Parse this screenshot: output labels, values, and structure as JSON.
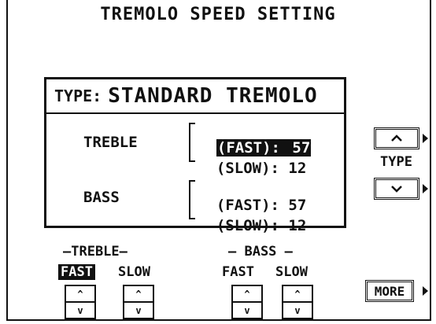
{
  "header": {
    "title": "TREMOLO SPEED SETTING"
  },
  "panel": {
    "type_prefix": "TYPE:",
    "type_name": "STANDARD TREMOLO",
    "treble": {
      "label": "TREBLE",
      "fast": {
        "label": "(FAST):",
        "value": "57"
      },
      "slow": {
        "label": "(SLOW):",
        "value": "12"
      }
    },
    "bass": {
      "label": "BASS",
      "fast": {
        "label": "(FAST):",
        "value": "57"
      },
      "slow": {
        "label": "(SLOW):",
        "value": "12"
      }
    }
  },
  "type_selector": {
    "label": "TYPE",
    "up_icon": "chevron-up",
    "down_icon": "chevron-down"
  },
  "controls": {
    "treble": {
      "group_label": "—TREBLE—",
      "fast_label": "FAST",
      "slow_label": "SLOW"
    },
    "bass": {
      "group_label": "— BASS —",
      "fast_label": "FAST",
      "slow_label": "SLOW"
    },
    "up_glyph": "^",
    "down_glyph": "v"
  },
  "more_button": {
    "label": "MORE"
  },
  "colors": {
    "foreground": "#111111",
    "background": "#ffffff"
  }
}
